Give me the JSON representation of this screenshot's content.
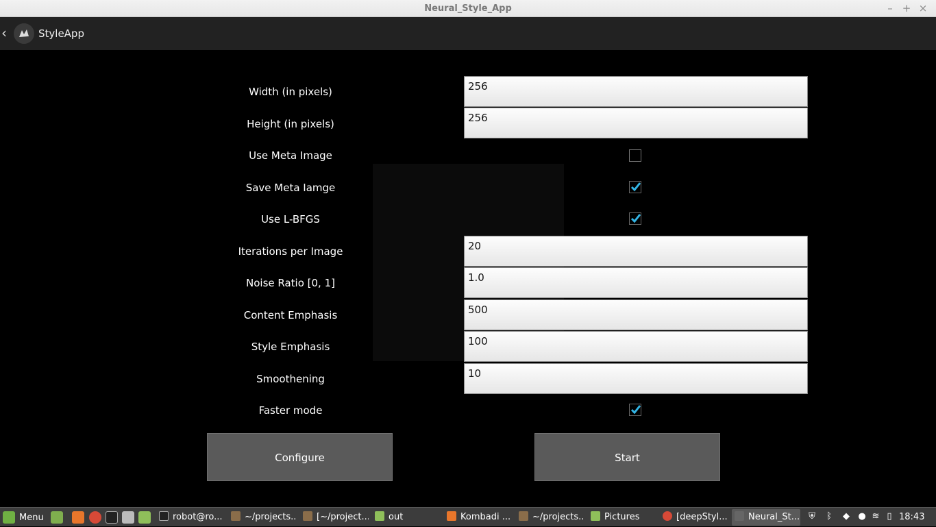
{
  "window": {
    "title": "Neural_Style_App",
    "controls": [
      "–",
      "+",
      "×"
    ]
  },
  "actionbar": {
    "app_name": "StyleApp"
  },
  "form": {
    "width": {
      "label": "Width (in pixels)",
      "value": "256"
    },
    "height": {
      "label": "Height (in pixels)",
      "value": "256"
    },
    "use_meta_image": {
      "label": "Use Meta Image",
      "checked": false
    },
    "save_meta_image": {
      "label": "Save Meta Iamge",
      "checked": true
    },
    "use_lbfgs": {
      "label": "Use L-BFGS",
      "checked": true
    },
    "iterations": {
      "label": "Iterations per Image",
      "value": "20"
    },
    "noise_ratio": {
      "label": "Noise Ratio [0, 1]",
      "value": "1.0"
    },
    "content_emphasis": {
      "label": "Content Emphasis",
      "value": "500"
    },
    "style_emphasis": {
      "label": "Style Emphasis",
      "value": "100"
    },
    "smoothening": {
      "label": "Smoothening",
      "value": "10"
    },
    "faster_mode": {
      "label": "Faster mode",
      "checked": true
    }
  },
  "buttons": {
    "configure": "Configure",
    "start": "Start"
  },
  "taskbar": {
    "menu_label": "Menu",
    "items": [
      "robot@ro...",
      "~/projects...",
      "[~/project...",
      "out",
      "Kombadi ...",
      "~/projects...",
      "Pictures",
      "[deepStyl...",
      "Neural_St..."
    ],
    "clock": "18:43"
  },
  "colors": {
    "check_accent": "#33b5e5",
    "button_bg": "#5a5a5a",
    "actionbar_bg": "#222222"
  }
}
